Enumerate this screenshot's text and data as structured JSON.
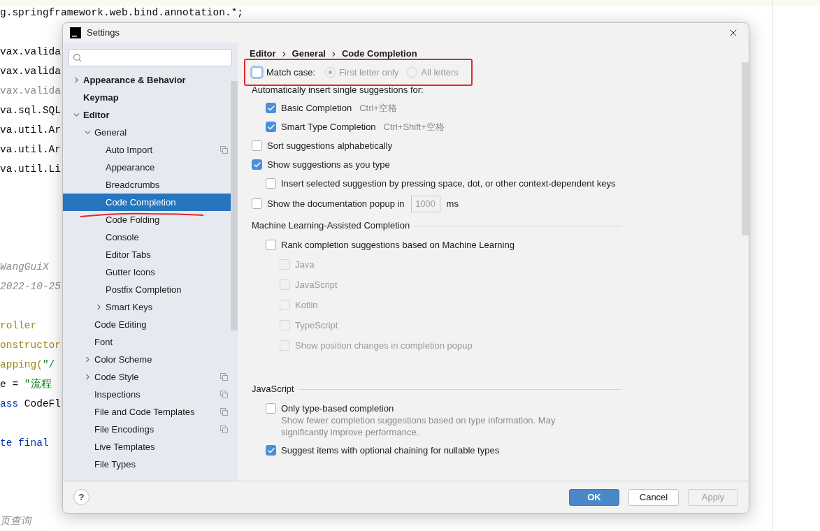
{
  "editor": {
    "lines": [
      {
        "segments": [
          {
            "text": "g.springframework.web.bind.annotation.*;",
            "kind": "plain"
          }
        ]
      },
      {
        "segments": [
          {
            "text": "vax.valida",
            "kind": "plain"
          }
        ]
      },
      {
        "segments": [
          {
            "text": "vax.valida",
            "kind": "plain"
          }
        ]
      },
      {
        "segments": [
          {
            "text": "vax.valida",
            "kind": "dim"
          }
        ]
      },
      {
        "segments": [
          {
            "text": "va.sql.SQL",
            "kind": "plain"
          }
        ]
      },
      {
        "segments": [
          {
            "text": "va.util.Ar",
            "kind": "plain"
          }
        ]
      },
      {
        "segments": [
          {
            "text": "va.util.Ar",
            "kind": "plain"
          }
        ]
      },
      {
        "segments": [
          {
            "text": "va.util.Li",
            "kind": "plain"
          }
        ]
      },
      {
        "segments": [
          {
            "text": "WangGuiX",
            "kind": "comment"
          }
        ]
      },
      {
        "segments": [
          {
            "text": "2022-10-25",
            "kind": "comment"
          }
        ]
      },
      {
        "segments": [
          {
            "text": "roller",
            "kind": "annotation"
          }
        ]
      },
      {
        "segments": [
          {
            "text": "onstructor",
            "kind": "annotation"
          }
        ]
      },
      {
        "segments": [
          {
            "text": "apping(",
            "kind": "annotation"
          },
          {
            "text": "\"/",
            "kind": "string"
          }
        ]
      },
      {
        "segments": [
          {
            "text": "e = ",
            "kind": "plain"
          },
          {
            "text": "\"流程",
            "kind": "string"
          }
        ]
      },
      {
        "segments": [
          {
            "text": "ass",
            "kind": "keyword"
          },
          {
            "text": " CodeFl",
            "kind": "plain"
          }
        ]
      },
      {
        "segments": [
          {
            "text": "te final",
            "kind": "keyword"
          }
        ]
      },
      {
        "segments": [
          {
            "text": "页查询",
            "kind": "comment"
          }
        ]
      }
    ]
  },
  "dialog": {
    "title": "Settings",
    "sidebar": {
      "items": [
        {
          "label": "Appearance & Behavior",
          "bold": true,
          "expanded": false,
          "selected": false
        },
        {
          "label": "Keymap",
          "bold": true,
          "selected": false
        },
        {
          "label": "Editor",
          "bold": true,
          "expanded": true,
          "selected": false,
          "children": [
            {
              "label": "General",
              "expanded": true,
              "selected": false,
              "children": [
                {
                  "label": "Auto Import",
                  "project_icon": true,
                  "selected": false
                },
                {
                  "label": "Appearance",
                  "selected": false
                },
                {
                  "label": "Breadcrumbs",
                  "selected": false
                },
                {
                  "label": "Code Completion",
                  "selected": true
                },
                {
                  "label": "Code Folding",
                  "selected": false
                },
                {
                  "label": "Console",
                  "selected": false
                },
                {
                  "label": "Editor Tabs",
                  "selected": false
                },
                {
                  "label": "Gutter Icons",
                  "selected": false
                },
                {
                  "label": "Postfix Completion",
                  "selected": false
                },
                {
                  "label": "Smart Keys",
                  "expanded": false,
                  "selected": false
                }
              ]
            },
            {
              "label": "Code Editing",
              "selected": false
            },
            {
              "label": "Font",
              "selected": false
            },
            {
              "label": "Color Scheme",
              "expanded": false,
              "selected": false
            },
            {
              "label": "Code Style",
              "expanded": false,
              "project_icon": true,
              "selected": false
            },
            {
              "label": "Inspections",
              "project_icon": true,
              "selected": false
            },
            {
              "label": "File and Code Templates",
              "project_icon": true,
              "selected": false
            },
            {
              "label": "File Encodings",
              "project_icon": true,
              "selected": false
            },
            {
              "label": "Live Templates",
              "selected": false
            },
            {
              "label": "File Types",
              "selected": false
            }
          ]
        }
      ]
    },
    "breadcrumbs": [
      "Editor",
      "General",
      "Code Completion"
    ],
    "rows": [
      {
        "kind": "radio_group",
        "label": "Match case:",
        "checked": false,
        "options": [
          {
            "label": "First letter only",
            "selected": true
          },
          {
            "label": "All letters",
            "selected": false
          }
        ]
      },
      {
        "kind": "label",
        "text": "Automatically insert single suggestions for:",
        "children": [
          {
            "kind": "checkbox",
            "label": "Basic Completion",
            "shortcut": "Ctrl+空格",
            "checked": true
          },
          {
            "kind": "checkbox",
            "label": "Smart Type Completion",
            "shortcut": "Ctrl+Shift+空格",
            "checked": true
          }
        ]
      },
      {
        "kind": "checkbox",
        "label": "Sort suggestions alphabetically",
        "checked": false
      },
      {
        "kind": "checkbox",
        "label": "Show suggestions as you type",
        "checked": true,
        "children": [
          {
            "kind": "checkbox",
            "label": "Insert selected suggestion by pressing space, dot, or other context-dependent keys",
            "checked": false
          }
        ]
      },
      {
        "kind": "checkbox_field",
        "label": "Show the documentation popup in",
        "value": "1000",
        "unit": "ms",
        "checked": false
      },
      {
        "kind": "section",
        "title": "Machine Learning-Assisted Completion",
        "children": [
          {
            "kind": "checkbox",
            "label": "Rank completion suggestions based on Machine Learning",
            "checked": false,
            "children": [
              {
                "kind": "checkbox",
                "label": "Java",
                "checked": false,
                "disabled": true
              },
              {
                "kind": "checkbox",
                "label": "JavaScript",
                "checked": false,
                "disabled": true
              },
              {
                "kind": "checkbox",
                "label": "Kotlin",
                "checked": false,
                "disabled": true
              },
              {
                "kind": "checkbox",
                "label": "TypeScript",
                "checked": false,
                "disabled": true
              },
              {
                "kind": "checkbox",
                "label": "Show position changes in completion popup",
                "checked": false,
                "disabled": true
              }
            ]
          }
        ]
      },
      {
        "kind": "section",
        "title": "JavaScript",
        "children": [
          {
            "kind": "checkbox",
            "label": "Only type-based completion",
            "description": "Show fewer completion suggestions based on type information. May significantly improve performance.",
            "checked": false
          },
          {
            "kind": "checkbox",
            "label": "Suggest items with optional chaining for nullable types",
            "checked": true
          }
        ]
      }
    ]
  },
  "footer": {
    "help": "?",
    "buttons": [
      {
        "label": "OK",
        "primary": true,
        "disabled": false
      },
      {
        "label": "Cancel",
        "primary": false,
        "disabled": false
      },
      {
        "label": "Apply",
        "primary": false,
        "disabled": true
      }
    ]
  }
}
